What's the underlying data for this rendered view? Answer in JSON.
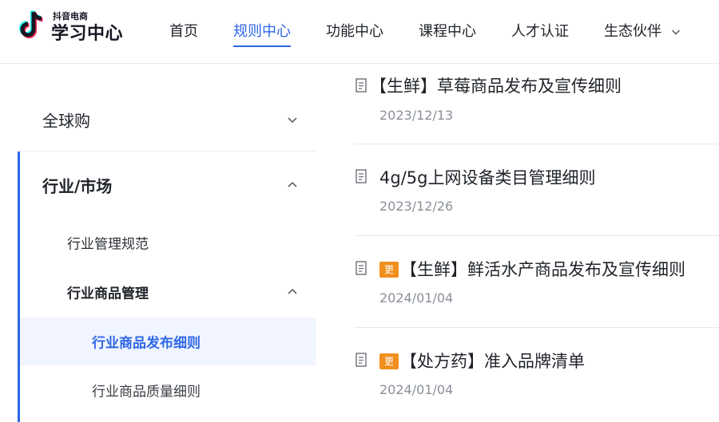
{
  "brand": {
    "top": "抖音电商",
    "main": "学习中心"
  },
  "nav": [
    {
      "label": "首页"
    },
    {
      "label": "规则中心",
      "active": true
    },
    {
      "label": "功能中心"
    },
    {
      "label": "课程中心"
    },
    {
      "label": "人才认证"
    },
    {
      "label": "生态伙伴",
      "has_dropdown": true
    }
  ],
  "sidebar": {
    "items": [
      {
        "label": "全球购",
        "level": 1,
        "expanded": false
      },
      {
        "label": "行业/市场",
        "level": 1,
        "expanded": true
      },
      {
        "label": "行业管理规范",
        "level": 2
      },
      {
        "label": "行业商品管理",
        "level": 2,
        "expanded": true
      },
      {
        "label": "行业商品发布细则",
        "level": 3,
        "selected": true
      },
      {
        "label": "行业商品质量细则",
        "level": 3
      }
    ]
  },
  "articles": [
    {
      "title": "【生鲜】草莓商品发布及宣传细则",
      "date": "2023/12/13",
      "badge": ""
    },
    {
      "title": "4g/5g上网设备类目管理细则",
      "date": "2023/12/26",
      "badge": ""
    },
    {
      "title": "【生鲜】鲜活水产商品发布及宣传细则",
      "date": "2024/01/04",
      "badge": "更"
    },
    {
      "title": "【处方药】准入品牌清单",
      "date": "2024/01/04",
      "badge": "更"
    }
  ],
  "colors": {
    "accent": "#2d66e6",
    "badge": "#f08f1e",
    "muted": "#8a8f99"
  }
}
